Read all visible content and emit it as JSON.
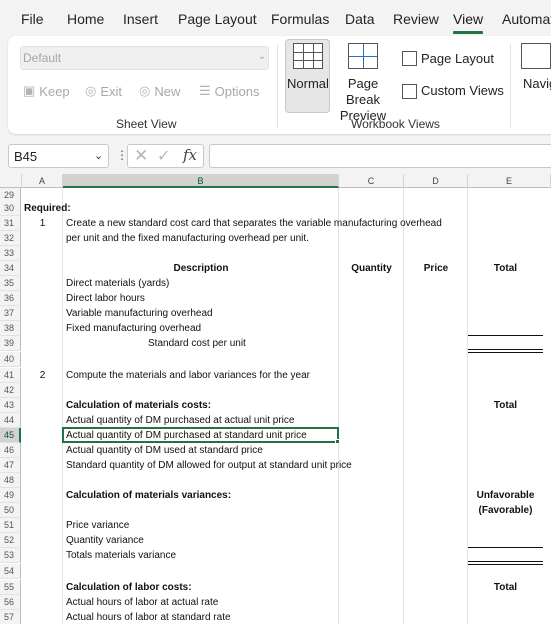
{
  "menu": {
    "items": [
      "File",
      "Home",
      "Insert",
      "Page Layout",
      "Formulas",
      "Data",
      "Review",
      "View",
      "Automat"
    ],
    "active": "View"
  },
  "ribbon": {
    "sheet_view": {
      "select_value": "Default",
      "keep": "Keep",
      "exit": "Exit",
      "new": "New",
      "options": "Options",
      "label": "Sheet View"
    },
    "workbook_views": {
      "normal": "Normal",
      "page_break_line1": "Page Break",
      "page_break_line2": "Preview",
      "page_layout": "Page Layout",
      "custom_views": "Custom Views",
      "label": "Workbook Views"
    },
    "navigation": "Navig"
  },
  "formula_bar": {
    "name_box": "B45",
    "fx": "fx",
    "formula": ""
  },
  "columns": [
    "A",
    "B",
    "C",
    "D",
    "E"
  ],
  "selected_column": "B",
  "selected_row": "45",
  "rows": [
    "29",
    "30",
    "31",
    "32",
    "33",
    "34",
    "35",
    "36",
    "37",
    "38",
    "39",
    "40",
    "41",
    "42",
    "43",
    "44",
    "45",
    "46",
    "47",
    "48",
    "49",
    "50",
    "51",
    "52",
    "53",
    "54",
    "55",
    "56",
    "57"
  ],
  "cells": {
    "r30a": "Required:",
    "r31a": "1",
    "r31b": "Create a new standard cost card that separates the variable manufacturing overhead",
    "r32b": "per unit and the fixed manufacturing overhead per unit.",
    "r34b": "Description",
    "r34c": "Quantity",
    "r34d": "Price",
    "r34e": "Total",
    "r35b": "Direct materials (yards)",
    "r36b": "Direct labor hours",
    "r37b": "Variable manufacturing overhead",
    "r38b": "Fixed manufacturing overhead",
    "r39b": "Standard cost per unit",
    "r41a": "2",
    "r41b": "Compute the materials and labor variances for the year",
    "r43b": "Calculation of materials costs:",
    "r43e": "Total",
    "r44b": "Actual quantity of DM purchased at actual unit price",
    "r45b": "Actual quantity of DM purchased at standard unit price",
    "r46b": "Actual quantity of DM used at standard price",
    "r47b": "Standard quantity of DM allowed for output at standard unit price",
    "r49b": "Calculation of materials variances:",
    "r49e": "Unfavorable",
    "r50e": "(Favorable)",
    "r51b": "Price variance",
    "r52b": "Quantity variance",
    "r53b": "Totals materials variance",
    "r55b": "Calculation of labor costs:",
    "r55e": "Total",
    "r56b": "Actual hours of labor at actual rate",
    "r57b": "Actual hours of labor at standard rate"
  },
  "colors": {
    "accent": "#217346",
    "chrome": "#f3f3f3"
  }
}
